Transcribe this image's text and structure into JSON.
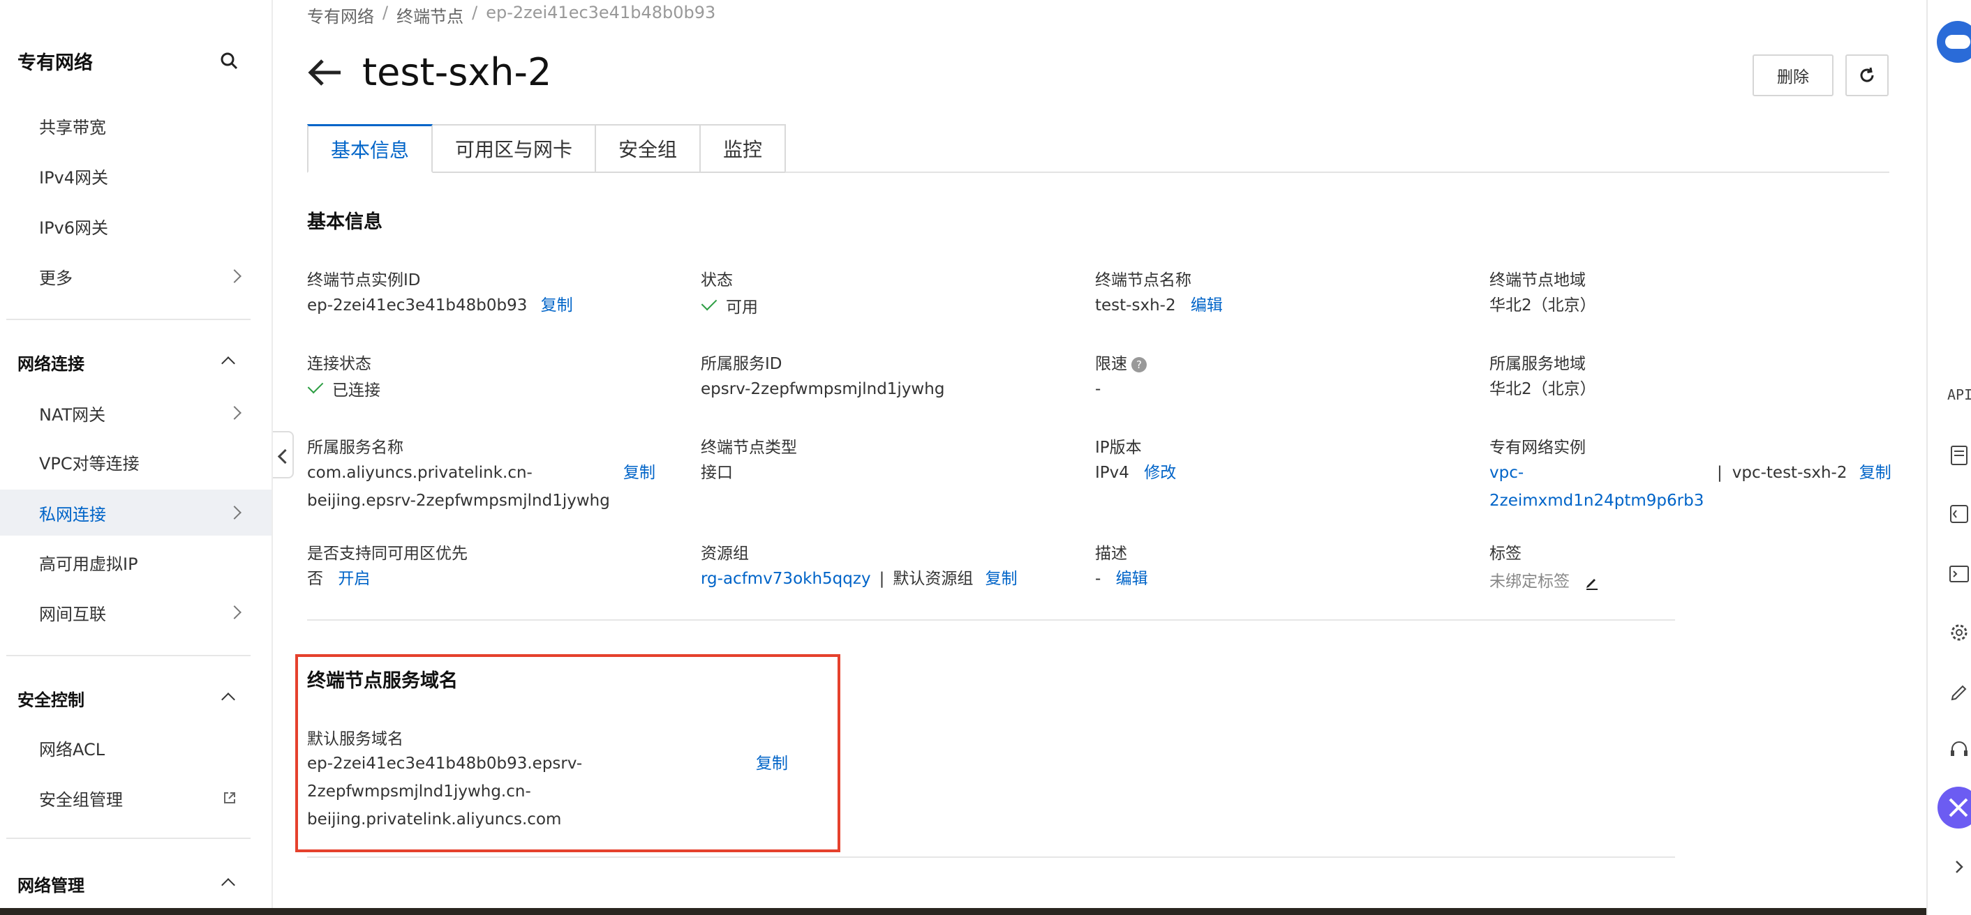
{
  "sidebar": {
    "title": "专有网络",
    "items_top": [
      "共享带宽",
      "IPv4网关",
      "IPv6网关",
      "更多"
    ],
    "group_network_connect": "网络连接",
    "items_connect": [
      "NAT网关",
      "VPC对等连接",
      "私网连接",
      "高可用虚拟IP",
      "网间互联"
    ],
    "group_security": "安全控制",
    "items_security": [
      "网络ACL",
      "安全组管理"
    ],
    "group_manage": "网络管理"
  },
  "breadcrumb": [
    "专有网络",
    "终端节点",
    "ep-2zei41ec3e41b48b0b93"
  ],
  "page": {
    "title": "test-sxh-2",
    "delete_label": "删除"
  },
  "tabs": [
    "基本信息",
    "可用区与网卡",
    "安全组",
    "监控"
  ],
  "basic": {
    "heading": "基本信息",
    "ep_id_label": "终端节点实例ID",
    "ep_id": "ep-2zei41ec3e41b48b0b93",
    "copy": "复制",
    "edit": "编辑",
    "modify": "修改",
    "enable": "开启",
    "status_label": "状态",
    "status": "可用",
    "name_label": "终端节点名称",
    "name": "test-sxh-2",
    "region_label": "终端节点地域",
    "region": "华北2（北京）",
    "conn_label": "连接状态",
    "conn": "已连接",
    "service_id_label": "所属服务ID",
    "service_id": "epsrv-2zepfwmpsmjlnd1jywhg",
    "limit_label": "限速",
    "limit": "-",
    "service_region_label": "所属服务地域",
    "service_region": "华北2（北京）",
    "service_name_label": "所属服务名称",
    "service_name_1": "com.aliyuncs.privatelink.cn-",
    "service_name_2": "beijing.epsrv-2zepfwmpsmjlnd1jywhg",
    "ep_type_label": "终端节点类型",
    "ep_type": "接口",
    "ip_ver_label": "IP版本",
    "ip_ver": "IPv4",
    "vpc_label": "专有网络实例",
    "vpc_id_1": "vpc-",
    "vpc_id_2": "2zeimxmd1n24ptm9p6rb3",
    "vpc_name": "vpc-test-sxh-2",
    "az_pref_label": "是否支持同可用区优先",
    "az_pref": "否",
    "rg_label": "资源组",
    "rg_id": "rg-acfmv73okh5qqzy",
    "rg_name": "默认资源组",
    "desc_label": "描述",
    "desc": "-",
    "tag_label": "标签",
    "tag": "未绑定标签"
  },
  "domain": {
    "heading": "终端节点服务域名",
    "label": "默认服务域名",
    "line1": "ep-2zei41ec3e41b48b0b93.epsrv-",
    "line2": "2zepfwmpsmjlnd1jywhg.cn-",
    "line3": "beijing.privatelink.aliyuncs.com",
    "copy": "复制"
  },
  "right_toolbar": {
    "api_label": "API"
  },
  "colors": {
    "accent": "#0064c8",
    "highlight_box": "#e5412d",
    "ok": "#2e9e44"
  }
}
